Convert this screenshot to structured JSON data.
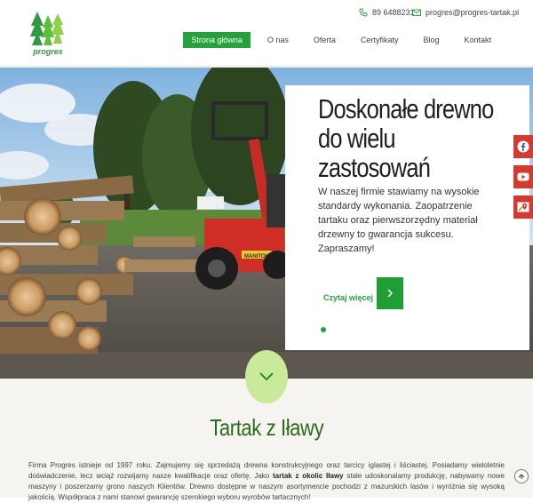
{
  "header": {
    "logo_text": "progres",
    "phone": "89 6488231",
    "email": "progres@progres-tartak.pl",
    "nav": [
      "Strona główna",
      "O nas",
      "Oferta",
      "Certyfikaty",
      "Blog",
      "Kontakt"
    ],
    "active_nav": "Strona główna"
  },
  "hero": {
    "title_line1": "Doskonałe drewno",
    "title_line2": "do wielu",
    "title_line3": "zastosowań",
    "text": "W naszej firmie stawiamy na wysokie standardy wykonania. Zaopatrzenie tartaku oraz pierwszorzędny materiał drzewny to gwarancja sukcesu. Zapraszamy!",
    "readmore": "Czytaj więcej",
    "forklift_brand": "MANITOU",
    "slide_count": 1,
    "active_slide": 1
  },
  "section": {
    "title": "Tartak z Iławy",
    "text_part1": "Firma Progres istnieje od 1997 roku. Zajmujemy się sprzedażą drewna konstrukcyjnego oraz tarcicy iglastej i liściastej. Posiadamy wieloletnie doświadczenie, lecz wciąż rozwijamy nasze kwalifikacje oraz ofertę. Jako ",
    "text_bold": "tartak z okolic Iławy",
    "text_part2": " stale udoskonalamy produkcję, nabywamy nowe maszyny i poszerzamy grono naszych Klientów. Drewno dostępne w naszym asortymencie pochodzi z mazurskich lasów i wyróżnia się wysoką jakością. Współpraca z nami stanowi gwarancję szerokiego wyboru wyrobów tartacznych!"
  },
  "colors": {
    "brand_green": "#23a33a",
    "title_green": "#2d6a1e",
    "social_red": "#d63a2f",
    "circle_green": "#c9e99b"
  }
}
